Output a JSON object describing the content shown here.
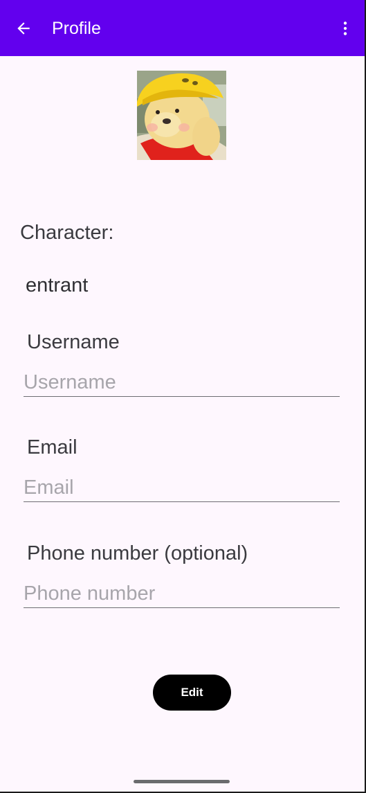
{
  "app_bar": {
    "title": "Profile",
    "background": "#6200ee",
    "back_icon": "arrow-back-icon",
    "menu_icon": "more-vert-icon"
  },
  "profile": {
    "avatar": "teddy-bear-photo",
    "character_label": "Character:",
    "character_value": "entrant"
  },
  "form": {
    "username": {
      "label": "Username",
      "value": "",
      "placeholder": "Username"
    },
    "email": {
      "label": "Email",
      "value": "",
      "placeholder": "Email"
    },
    "phone": {
      "label": "Phone number (optional)",
      "value": "",
      "placeholder": "Phone number"
    }
  },
  "actions": {
    "edit_label": "Edit"
  }
}
